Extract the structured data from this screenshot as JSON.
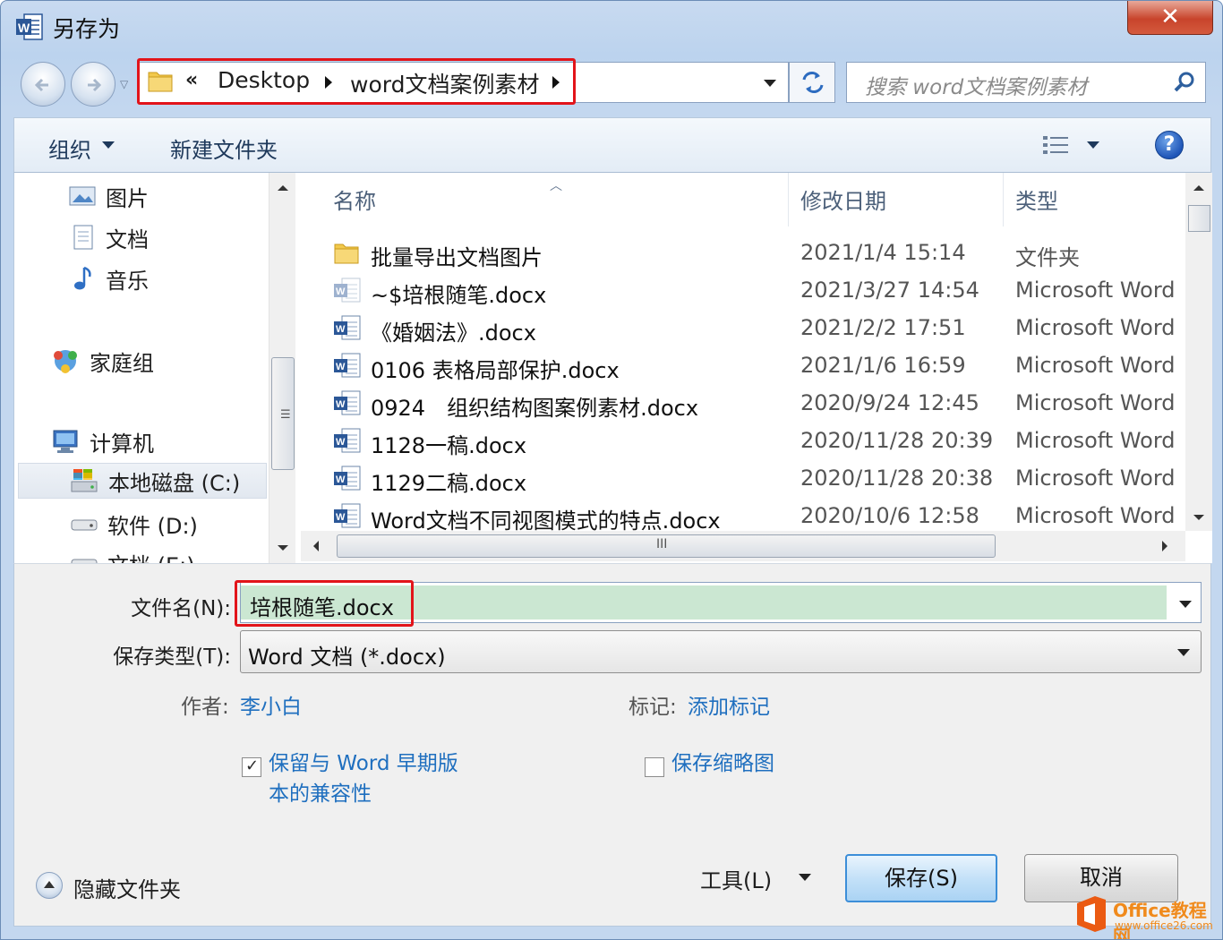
{
  "window": {
    "title": "另存为",
    "close_label": "✕"
  },
  "address": {
    "chevron": "«",
    "segments": [
      "Desktop",
      "word文档案例素材"
    ]
  },
  "search": {
    "placeholder": "搜索 word文档案例素材"
  },
  "toolbar": {
    "organize_label": "组织",
    "new_folder_label": "新建文件夹",
    "help_label": "?"
  },
  "nav": {
    "items": [
      {
        "label": "图片",
        "icon": "pictures-icon"
      },
      {
        "label": "文档",
        "icon": "documents-icon"
      },
      {
        "label": "音乐",
        "icon": "music-icon"
      },
      {
        "label": "家庭组",
        "icon": "homegroup-icon"
      },
      {
        "label": "计算机",
        "icon": "computer-icon"
      },
      {
        "label": "本地磁盘 (C:)",
        "icon": "local-disk-icon",
        "selected": true
      },
      {
        "label": "软件 (D:)",
        "icon": "drive-icon"
      },
      {
        "label": "文档 (E:)",
        "icon": "drive-icon"
      }
    ]
  },
  "filelist": {
    "columns": {
      "name": "名称",
      "date": "修改日期",
      "type": "类型"
    },
    "rows": [
      {
        "name": "批量导出文档图片",
        "date": "2021/1/4 15:14",
        "type": "文件夹",
        "kind": "folder"
      },
      {
        "name": "~$培根随笔.docx",
        "date": "2021/3/27 14:54",
        "type": "Microsoft Word",
        "kind": "word-temp"
      },
      {
        "name": "《婚姻法》.docx",
        "date": "2021/2/2 17:51",
        "type": "Microsoft Word",
        "kind": "word"
      },
      {
        "name": "0106 表格局部保护.docx",
        "date": "2021/1/6 16:59",
        "type": "Microsoft Word",
        "kind": "word"
      },
      {
        "name": "0924　组织结构图案例素材.docx",
        "date": "2020/9/24 12:45",
        "type": "Microsoft Word",
        "kind": "word"
      },
      {
        "name": "1128一稿.docx",
        "date": "2020/11/28 20:39",
        "type": "Microsoft Word",
        "kind": "word"
      },
      {
        "name": "1129二稿.docx",
        "date": "2020/11/28 20:38",
        "type": "Microsoft Word",
        "kind": "word"
      },
      {
        "name": "Word文档不同视图模式的特点.docx",
        "date": "2020/10/6 12:58",
        "type": "Microsoft Word",
        "kind": "word"
      }
    ]
  },
  "form": {
    "filename_label": "文件名(N):",
    "filename_value": "培根随笔.docx",
    "savetype_label": "保存类型(T):",
    "savetype_value": "Word 文档 (*.docx)",
    "author_label": "作者:",
    "author_value": "李小白",
    "tags_label": "标记:",
    "tags_value": "添加标记",
    "compat_line1": "保留与 Word 早期版",
    "compat_line2": "本的兼容性",
    "compat_checked": true,
    "thumb_label": "保存缩略图",
    "thumb_checked": false
  },
  "footer": {
    "hide_folders_label": "隐藏文件夹",
    "tools_label": "工具(L)",
    "save_label": "保存(S)",
    "cancel_label": "取消"
  },
  "watermark": {
    "brand": "Office教程网",
    "url": "www.office26.com"
  },
  "colors": {
    "highlight_red": "#e2141a",
    "link_blue": "#1f6fbf",
    "filename_selection": "#cbe7d2"
  }
}
